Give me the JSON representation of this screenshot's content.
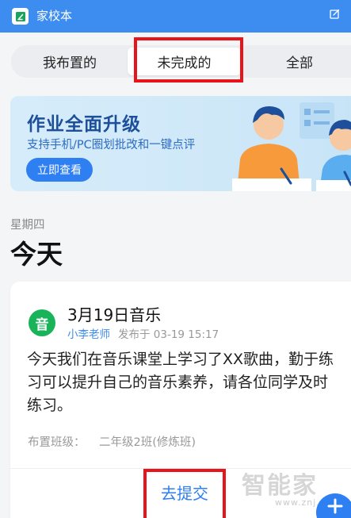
{
  "app": {
    "title": "家校本"
  },
  "tabs": [
    {
      "label": "我布置的",
      "active": false
    },
    {
      "label": "未完成的",
      "active": true
    },
    {
      "label": "全部",
      "active": false
    }
  ],
  "banner": {
    "title": "作业全面升级",
    "subtitle": "支持手机/PC圈划批改和一键点评",
    "button_label": "立即查看"
  },
  "day": {
    "weekday": "星期四",
    "title": "今天"
  },
  "assignment": {
    "avatar_text": "音",
    "title": "3月19日音乐",
    "teacher": "小李老师",
    "posted": "发布于 03-19 15:17",
    "body": "今天我们在音乐课堂上学习了XX歌曲，勤于练习可以提升自己的音乐素养，请各位同学及时练习。",
    "class_label": "布置班级：",
    "class_value": "二年级2班(修炼班)",
    "submit_label": "去提交"
  },
  "watermark": {
    "main": "智能家",
    "url": "www.znj.com"
  },
  "colors": {
    "primary": "#3d8cf0",
    "accent_blue": "#2e7ff2",
    "avatar_green": "#19b35a",
    "highlight_red": "#e8141c"
  },
  "icons": {
    "app": "notebook-icon",
    "edit": "edit-icon",
    "fab": "plus-icon"
  }
}
